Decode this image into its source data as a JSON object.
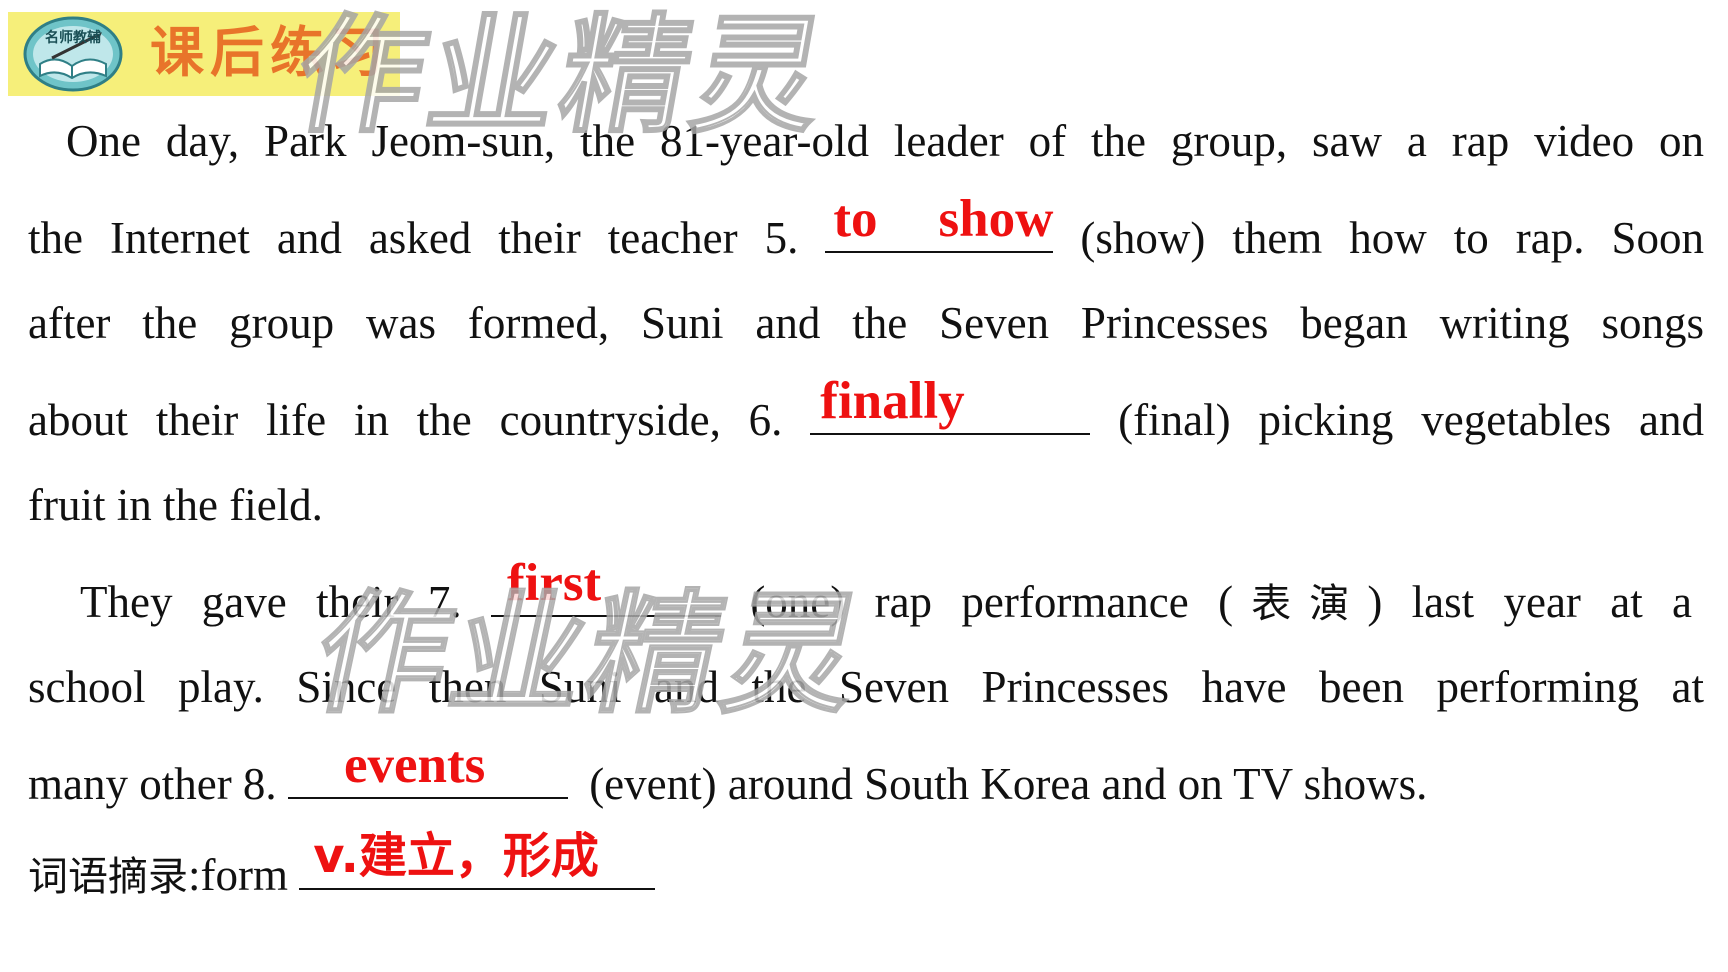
{
  "header": {
    "title": "课后练习",
    "logo_text": "名师教辅",
    "logo_icon": "open-book-with-pen-icon",
    "band_color": "#f6ef7a",
    "title_color": "#e8742a"
  },
  "watermark": {
    "text": "作业精灵"
  },
  "answer_color": "#ee1111",
  "lines": [
    {
      "text": "One day, Park Jeom-sun, the 81-year-old leader of the group, saw a rap video on"
    },
    {
      "before": "the Internet and asked their teacher 5.",
      "answer": "to show",
      "after": "(show) them how to rap. Soon"
    },
    {
      "text": "after the group was formed, Suni and the Seven Princesses began writing songs"
    },
    {
      "before": "about their life in the countryside, 6.",
      "answer": "finally",
      "after": "(final) picking vegetables and"
    },
    {
      "text": "fruit in the field."
    },
    {
      "before": "They gave their 7.",
      "answer": "first",
      "after_en": "(one) rap performance (",
      "after_cjk": "表演",
      "after_end": ") last year at a"
    },
    {
      "text": "school play. Since then Suni and the Seven Princesses have been performing at"
    },
    {
      "before": "many other 8.",
      "answer": "events",
      "after": "(event) around South Korea and on TV shows."
    }
  ],
  "vocab": {
    "label_cjk": "词语摘录",
    "label_en": ":form",
    "answer": "v.建立，形成"
  }
}
